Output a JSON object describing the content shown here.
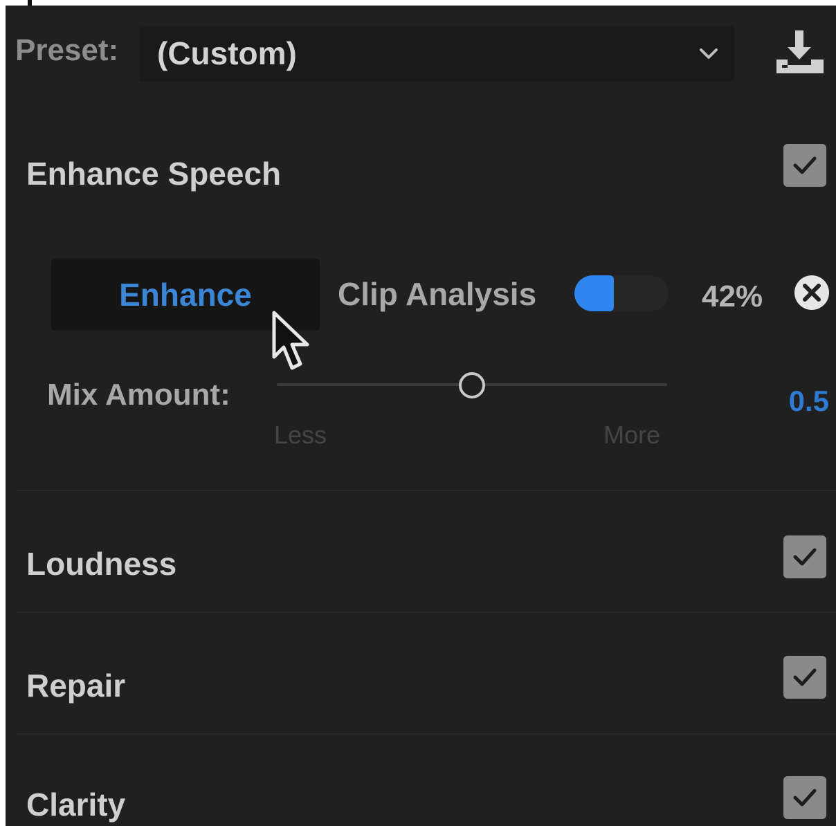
{
  "preset": {
    "label": "Preset:",
    "value": "(Custom)"
  },
  "sections": {
    "enhance_speech": {
      "title": "Enhance Speech",
      "checked": true,
      "enhance_button": "Enhance",
      "clip_analysis": {
        "label": "Clip Analysis",
        "progress_text": "42%",
        "progress": 0.42
      },
      "mix_amount": {
        "label": "Mix Amount:",
        "value_text": "0.5",
        "value": 0.5,
        "min_label": "Less",
        "max_label": "More"
      }
    },
    "loudness": {
      "title": "Loudness",
      "checked": true
    },
    "repair": {
      "title": "Repair",
      "checked": true
    },
    "clarity": {
      "title": "Clarity",
      "checked": true
    }
  },
  "icons": [
    "chevron-down-icon",
    "download-icon",
    "check-icon",
    "cancel-icon",
    "cursor-icon"
  ],
  "colors": {
    "accent": "#2f86f0",
    "panel_bg": "#202020",
    "checkbox": "#8a8a8a"
  }
}
